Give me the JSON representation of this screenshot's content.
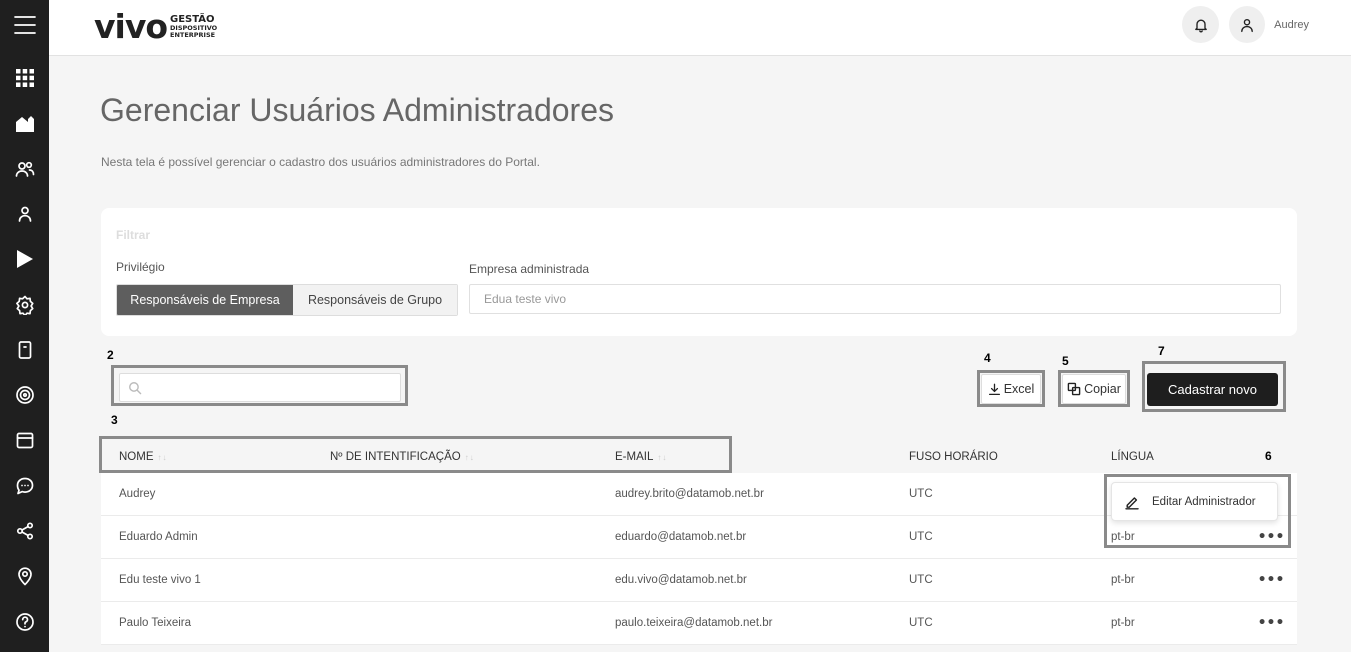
{
  "header": {
    "logo": {
      "word": "vivo",
      "line1": "GESTÃO",
      "line2": "DISPOSITIVO",
      "line3": "ENTERPRISE"
    },
    "user_name": "Audrey"
  },
  "sidebar": {
    "icons": [
      "menu-icon",
      "apps-icon",
      "home-icon",
      "users-icon",
      "user-icon",
      "play-icon",
      "settings-icon",
      "device-icon",
      "target-icon",
      "calendar-icon",
      "chat-icon",
      "share-icon",
      "location-icon",
      "help-icon"
    ]
  },
  "page": {
    "title": "Gerenciar Usuários Administradores",
    "description": "Nesta tela é possível gerenciar o cadastro dos usuários administradores do Portal."
  },
  "filter": {
    "title": "Filtrar",
    "privilege_label": "Privilégio",
    "privilege_options": [
      "Responsáveis de Empresa",
      "Responsáveis de Grupo"
    ],
    "privilege_selected": "Responsáveis de Empresa",
    "company_label": "Empresa administrada",
    "company_value": "Edua teste vivo"
  },
  "annotations": {
    "n2": "2",
    "n3": "3",
    "n4": "4",
    "n5": "5",
    "n6": "6",
    "n7": "7"
  },
  "toolbar": {
    "search_placeholder": "",
    "excel_label": "Excel",
    "copy_label": "Copiar",
    "new_label": "Cadastrar novo"
  },
  "table": {
    "headers": {
      "name": "NOME",
      "id": "Nº DE INTENTIFICAÇÃO",
      "email": "E-MAIL",
      "tz": "FUSO HORÁRIO",
      "lang": "LÍNGUA",
      "sort_arrows": "↑↓"
    },
    "rows": [
      {
        "name": "Audrey",
        "id": "",
        "email": "audrey.brito@datamob.net.br",
        "tz": "UTC",
        "lang": ""
      },
      {
        "name": "Eduardo Admin",
        "id": "",
        "email": "eduardo@datamob.net.br",
        "tz": "UTC",
        "lang": "pt-br"
      },
      {
        "name": "Edu teste vivo 1",
        "id": "",
        "email": "edu.vivo@datamob.net.br",
        "tz": "UTC",
        "lang": "pt-br"
      },
      {
        "name": "Paulo Teixeira",
        "id": "",
        "email": "paulo.teixeira@datamob.net.br",
        "tz": "UTC",
        "lang": "pt-br"
      }
    ],
    "row_menu_label": "•••",
    "row_menu_popup": "Editar Administrador"
  }
}
